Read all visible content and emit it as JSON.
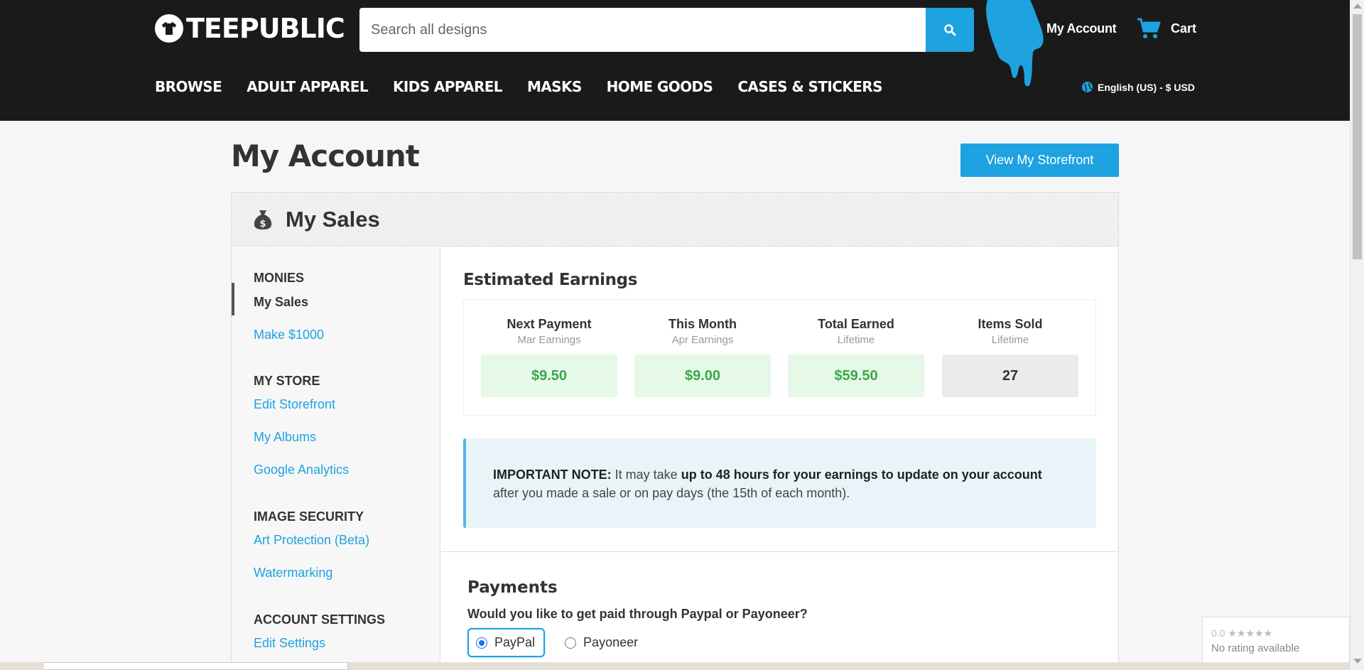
{
  "header": {
    "logo_text": "TEEPUBLIC",
    "search_placeholder": "Search all designs",
    "account_label": "My Account",
    "cart_label": "Cart",
    "locale_label": "English (US) - $ USD",
    "nav": [
      "BROWSE",
      "ADULT APPAREL",
      "KIDS APPAREL",
      "MASKS",
      "HOME GOODS",
      "CASES & STICKERS"
    ]
  },
  "page": {
    "title": "My Account",
    "storefront_button": "View My Storefront"
  },
  "panel": {
    "title": "My Sales",
    "icon": "money-bag-icon"
  },
  "sidebar": {
    "sections": [
      {
        "heading": "MONIES",
        "items": [
          "My Sales",
          "Make $1000"
        ],
        "active": "My Sales"
      },
      {
        "heading": "MY STORE",
        "items": [
          "Edit Storefront",
          "My Albums",
          "Google Analytics"
        ]
      },
      {
        "heading": "IMAGE SECURITY",
        "items": [
          "Art Protection (Beta)",
          "Watermarking"
        ]
      },
      {
        "heading": "ACCOUNT SETTINGS",
        "items": [
          "Edit Settings"
        ]
      }
    ]
  },
  "earnings": {
    "title": "Estimated Earnings",
    "stats": [
      {
        "label": "Next Payment",
        "sub": "Mar Earnings",
        "value": "$9.50"
      },
      {
        "label": "This Month",
        "sub": "Apr Earnings",
        "value": "$9.00"
      },
      {
        "label": "Total Earned",
        "sub": "Lifetime",
        "value": "$59.50"
      },
      {
        "label": "Items Sold",
        "sub": "Lifetime",
        "value": "27"
      }
    ]
  },
  "note": {
    "lead": "IMPORTANT NOTE:",
    "text1": " It may take ",
    "bold": "up to 48 hours for your earnings to update on your account",
    "text2": " after you made a sale or on pay days (the 15th of each month)."
  },
  "payments": {
    "title": "Payments",
    "question": "Would you like to get paid through Paypal or Payoneer?",
    "options": [
      "PayPal",
      "Payoneer"
    ],
    "selected": "PayPal"
  },
  "rating": {
    "score": "0.0",
    "stars": "★★★★★",
    "text": "No rating available"
  },
  "colors": {
    "accent": "#1ea2e0",
    "header_bg": "#1a1a1a",
    "money_green": "#3aa84a"
  }
}
